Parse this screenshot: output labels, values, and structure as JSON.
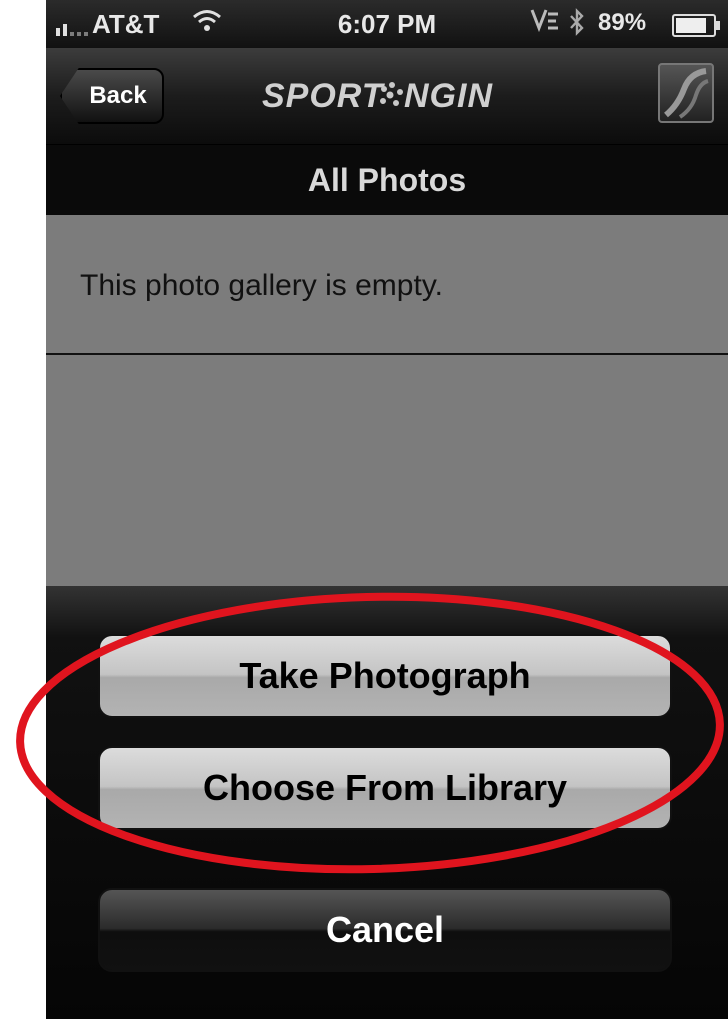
{
  "status_bar": {
    "carrier": "AT&T",
    "time": "6:07 PM",
    "battery_percent": "89%",
    "battery_level": 0.89,
    "icons": [
      "signal-icon",
      "wifi-icon",
      "vpn-icon",
      "bluetooth-icon",
      "battery-icon"
    ]
  },
  "nav_bar": {
    "back_label": "Back",
    "brand_logo_text": "SPORTNGIN",
    "menu_icon": "menu-logo-icon"
  },
  "section": {
    "title": "All Photos"
  },
  "gallery": {
    "empty_message": "This photo gallery is empty."
  },
  "action_sheet": {
    "take_photo_label": "Take Photograph",
    "choose_library_label": "Choose From Library",
    "cancel_label": "Cancel"
  },
  "colors": {
    "annotation": "#e0141e",
    "content_bg": "#7c7c7c",
    "header_bg": "#0a0a0a"
  }
}
